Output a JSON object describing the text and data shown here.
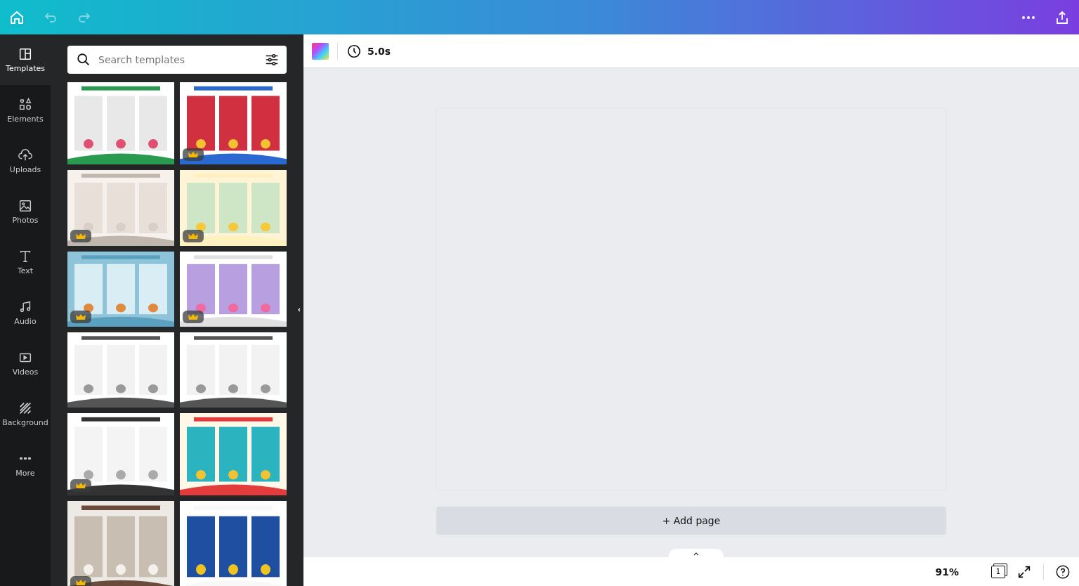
{
  "sidebar": {
    "items": [
      {
        "label": "Templates",
        "selected": true
      },
      {
        "label": "Elements",
        "selected": false
      },
      {
        "label": "Uploads",
        "selected": false
      },
      {
        "label": "Photos",
        "selected": false
      },
      {
        "label": "Text",
        "selected": false
      },
      {
        "label": "Audio",
        "selected": false
      },
      {
        "label": "Videos",
        "selected": false
      },
      {
        "label": "Background",
        "selected": false
      },
      {
        "label": "More",
        "selected": false
      }
    ]
  },
  "search": {
    "placeholder": "Search templates"
  },
  "templates": [
    {
      "kind": "picture",
      "premium": false
    },
    {
      "kind": "picture",
      "premium": true
    },
    {
      "kind": "picture",
      "premium": true
    },
    {
      "kind": "picture",
      "premium": true
    },
    {
      "kind": "picture",
      "premium": true
    },
    {
      "kind": "picture",
      "premium": true
    },
    {
      "kind": "picture",
      "premium": false
    },
    {
      "kind": "picture",
      "premium": false
    },
    {
      "kind": "picture",
      "premium": true
    },
    {
      "kind": "picture",
      "premium": false
    },
    {
      "kind": "picture",
      "premium": true
    },
    {
      "kind": "picture",
      "premium": false
    }
  ],
  "toolbar": {
    "duration": "5.0s"
  },
  "canvas": {
    "add_page": "+ Add page"
  },
  "footer": {
    "zoom": "91%",
    "page_count": "1"
  }
}
